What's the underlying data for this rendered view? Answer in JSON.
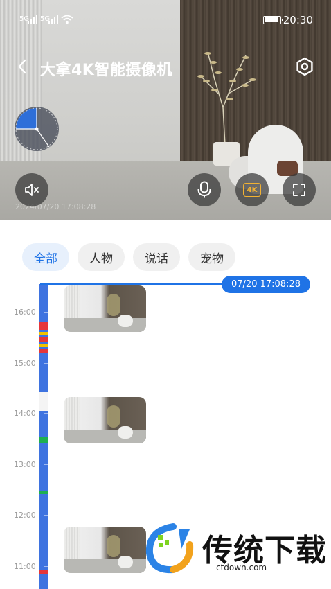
{
  "status_bar": {
    "signal_1": "5G",
    "signal_2": "5G",
    "time": "20:30",
    "icons": [
      "signal-icon",
      "signal-icon",
      "wifi-icon",
      "battery-icon"
    ]
  },
  "header": {
    "title": "大拿4K智能摄像机",
    "back_icon": "chevron-left-icon",
    "settings_icon": "hexagon-settings-icon"
  },
  "preview": {
    "timestamp": "2024/07/20 17:08:28",
    "controls": {
      "mute_icon": "speaker-muted-icon",
      "mic_icon": "microphone-icon",
      "quality_label": "4K",
      "fullscreen_icon": "fullscreen-icon"
    }
  },
  "filters": {
    "tabs": [
      {
        "label": "全部",
        "active": true
      },
      {
        "label": "人物",
        "active": false
      },
      {
        "label": "说话",
        "active": false
      },
      {
        "label": "宠物",
        "active": false
      }
    ]
  },
  "timeline": {
    "current_time": "07/20 17:08:28",
    "hours": [
      "16:00",
      "15:00",
      "14:00",
      "13:00",
      "12:00",
      "11:00"
    ]
  },
  "watermark": {
    "text": "传统下载",
    "url": "ctdown.com"
  },
  "colors": {
    "accent": "#1f73e6",
    "timeline_bar": "#3e73e0",
    "event_red": "#e5373b",
    "event_yellow": "#f2c200",
    "event_green": "#1fb050",
    "quality_gold": "#f2b233"
  }
}
